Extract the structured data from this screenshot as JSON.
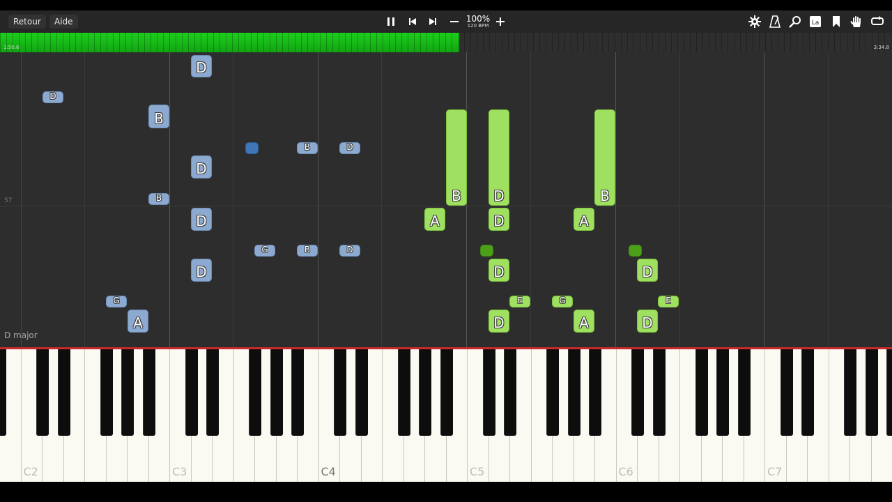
{
  "toolbar": {
    "back_label": "Retour",
    "help_label": "Aide",
    "speed_percent": "100%",
    "speed_bpm": "120 BPM",
    "icons": [
      "pause-icon",
      "skip-back-icon",
      "skip-forward-icon",
      "minus-icon",
      "plus-icon",
      "gear-icon",
      "metronome-icon",
      "search-icon",
      "note-name-icon",
      "bookmark-icon",
      "hand-icon",
      "loop-icon"
    ]
  },
  "progress": {
    "fraction": 0.515,
    "current_time": "1:50.6",
    "total_time": "3:34.8"
  },
  "roll": {
    "row_label": "57",
    "key_signature": "D major",
    "colors": {
      "left_hand": "#8caad0",
      "right_hand": "#9fe060",
      "progress": "#1ccf1c"
    }
  },
  "notes": [
    {
      "hand": "left",
      "label": "D"
    },
    {
      "hand": "left",
      "label": "D"
    },
    {
      "hand": "left",
      "label": "B"
    },
    {
      "hand": "left",
      "label": "D"
    },
    {
      "hand": "left",
      "label": ""
    },
    {
      "hand": "left",
      "label": "B"
    },
    {
      "hand": "left",
      "label": "D"
    },
    {
      "hand": "left",
      "label": "B"
    },
    {
      "hand": "left",
      "label": "D"
    },
    {
      "hand": "left",
      "label": "G"
    },
    {
      "hand": "left",
      "label": "B"
    },
    {
      "hand": "left",
      "label": "D"
    },
    {
      "hand": "left",
      "label": "D"
    },
    {
      "hand": "left",
      "label": "G"
    },
    {
      "hand": "left",
      "label": "A"
    },
    {
      "hand": "right",
      "label": "B"
    },
    {
      "hand": "right",
      "label": "D"
    },
    {
      "hand": "right",
      "label": "B"
    },
    {
      "hand": "right",
      "label": "A"
    },
    {
      "hand": "right",
      "label": "D"
    },
    {
      "hand": "right",
      "label": "A"
    },
    {
      "hand": "right",
      "label": ""
    },
    {
      "hand": "right",
      "label": ""
    },
    {
      "hand": "right",
      "label": "D"
    },
    {
      "hand": "right",
      "label": "D"
    },
    {
      "hand": "right",
      "label": "E"
    },
    {
      "hand": "right",
      "label": "G"
    },
    {
      "hand": "right",
      "label": "E"
    },
    {
      "hand": "right",
      "label": "D"
    },
    {
      "hand": "right",
      "label": "A"
    },
    {
      "hand": "right",
      "label": "D"
    }
  ],
  "keyboard": {
    "octave_labels": [
      "C2",
      "C3",
      "C4",
      "C5",
      "C6",
      "C7"
    ]
  }
}
